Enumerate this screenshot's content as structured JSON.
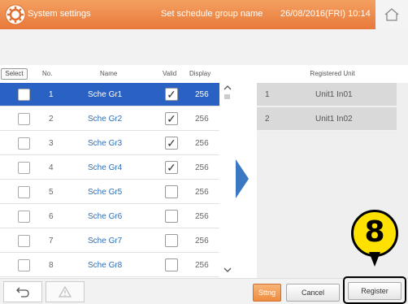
{
  "header": {
    "title": "System settings",
    "subtitle": "Set schedule group name",
    "datetime": "26/08/2016(FRI) 10:14"
  },
  "table": {
    "select_label": "Select",
    "col_no": "No.",
    "col_name": "Name",
    "col_valid": "Valid",
    "col_display": "Display",
    "rows": [
      {
        "no": "1",
        "name": "Sche Gr1",
        "valid": "✓",
        "display": "256"
      },
      {
        "no": "2",
        "name": "Sche Gr2",
        "valid": "✓",
        "display": "256"
      },
      {
        "no": "3",
        "name": "Sche Gr3",
        "valid": "✓",
        "display": "256"
      },
      {
        "no": "4",
        "name": "Sche Gr4",
        "valid": "✓",
        "display": "256"
      },
      {
        "no": "5",
        "name": "Sche Gr5",
        "valid": "",
        "display": "256"
      },
      {
        "no": "6",
        "name": "Sche Gr6",
        "valid": "",
        "display": "256"
      },
      {
        "no": "7",
        "name": "Sche Gr7",
        "valid": "",
        "display": "256"
      },
      {
        "no": "8",
        "name": "Sche Gr8",
        "valid": "",
        "display": "256"
      }
    ]
  },
  "registered": {
    "header": "Registered Unit",
    "rows": [
      {
        "no": "1",
        "unit": "Unit1 In01"
      },
      {
        "no": "2",
        "unit": "Unit1 In02"
      }
    ]
  },
  "buttons": {
    "sttng": "Sttng",
    "cancel": "Cancel",
    "register": "Register"
  },
  "callout": "8",
  "colors": {
    "header": "#ef8c40",
    "selected_row": "#2a62c4",
    "accent_blue": "#3b78c4",
    "callout": "#ffe100"
  },
  "icons": [
    "settings-gear-icon",
    "home-icon",
    "back-arrow-icon",
    "warning-icon",
    "scroll-up-icon",
    "scroll-down-icon",
    "transfer-arrow-icon"
  ]
}
